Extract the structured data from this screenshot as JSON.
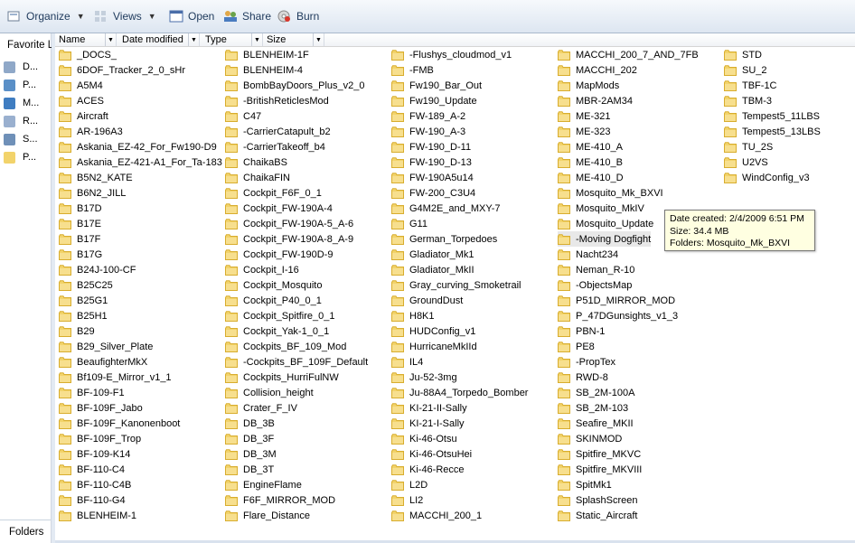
{
  "toolbar": {
    "organize": "Organize",
    "views": "Views",
    "open": "Open",
    "share": "Share",
    "burn": "Burn"
  },
  "nav": {
    "favorites": "Favorite L",
    "items": [
      "D...",
      "P...",
      "M...",
      "R...",
      "S...",
      "P..."
    ],
    "folders": "Folders"
  },
  "columns": [
    "Name",
    "Date modified",
    "Type",
    "Size"
  ],
  "folders": [
    [
      "_DOCS_",
      "6DOF_Tracker_2_0_sHr",
      "A5M4",
      "ACES",
      "Aircraft",
      "AR-196A3",
      "Askania_EZ-42_For_Fw190-D9",
      "Askania_EZ-421-A1_For_Ta-183",
      "B5N2_KATE",
      "B6N2_JILL",
      "B17D",
      "B17E",
      "B17F",
      "B17G",
      "B24J-100-CF",
      "B25C25",
      "B25G1",
      "B25H1",
      "B29",
      "B29_Silver_Plate",
      "BeaufighterMkX",
      "Bf109-E_Mirror_v1_1",
      "BF-109-F1",
      "BF-109F_Jabo",
      "BF-109F_Kanonenboot",
      "BF-109F_Trop",
      "BF-109-K14",
      "BF-110-C4",
      "BF-110-C4B",
      "BF-110-G4",
      "BLENHEIM-1"
    ],
    [
      "BLENHEIM-1F",
      "BLENHEIM-4",
      "BombBayDoors_Plus_v2_0",
      "-BritishReticlesMod",
      "C47",
      "-CarrierCatapult_b2",
      "-CarrierTakeoff_b4",
      "ChaikaBS",
      "ChaikaFIN",
      "Cockpit_F6F_0_1",
      "Cockpit_FW-190A-4",
      "Cockpit_FW-190A-5_A-6",
      "Cockpit_FW-190A-8_A-9",
      "Cockpit_FW-190D-9",
      "Cockpit_I-16",
      "Cockpit_Mosquito",
      "Cockpit_P40_0_1",
      "Cockpit_Spitfire_0_1",
      "Cockpit_Yak-1_0_1",
      "Cockpits_BF_109_Mod",
      "-Cockpits_BF_109F_Default",
      "Cockpits_HurriFulNW",
      "Collision_height",
      "Crater_F_IV",
      "DB_3B",
      "DB_3F",
      "DB_3M",
      "DB_3T",
      "EngineFlame",
      "F6F_MIRROR_MOD",
      "Flare_Distance"
    ],
    [
      "-Flushys_cloudmod_v1",
      "-FMB",
      "Fw190_Bar_Out",
      "Fw190_Update",
      "FW-189_A-2",
      "FW-190_A-3",
      "FW-190_D-11",
      "FW-190_D-13",
      "FW-190A5u14",
      "FW-200_C3U4",
      "G4M2E_and_MXY-7",
      "G11",
      "German_Torpedoes",
      "Gladiator_Mk1",
      "Gladiator_MkII",
      "Gray_curving_Smoketrail",
      "GroundDust",
      "H8K1",
      "HUDConfig_v1",
      "HurricaneMkIId",
      "IL4",
      "Ju-52-3mg",
      "Ju-88A4_Torpedo_Bomber",
      "KI-21-II-Sally",
      "KI-21-I-Sally",
      "Ki-46-Otsu",
      "Ki-46-OtsuHei",
      "Ki-46-Recce",
      "L2D",
      "LI2",
      "MACCHI_200_1"
    ],
    [
      "MACCHI_200_7_AND_7FB",
      "MACCHI_202",
      "MapMods",
      "MBR-2AM34",
      "ME-321",
      "ME-323",
      "ME-410_A",
      "ME-410_B",
      "ME-410_D",
      "Mosquito_Mk_BXVI",
      "Mosquito_MkIV",
      "Mosquito_Update",
      "-Moving Dogfight",
      "Nacht234",
      "Neman_R-10",
      "-ObjectsMap",
      "P51D_MIRROR_MOD",
      "P_47DGunsights_v1_3",
      "PBN-1",
      "PE8",
      "-PropTex",
      "RWD-8",
      "SB_2M-100A",
      "SB_2M-103",
      "Seafire_MKII",
      "SKINMOD",
      "Spitfire_MKVC",
      "Spitfire_MKVIII",
      "SpitMk1",
      "SplashScreen",
      "Static_Aircraft"
    ],
    [
      "STD",
      "SU_2",
      "TBF-1C",
      "TBM-3",
      "Tempest5_11LBS",
      "Tempest5_13LBS",
      "TU_2S",
      "U2VS",
      "WindConfig_v3"
    ]
  ],
  "selected": "-Moving Dogfight",
  "tooltip": {
    "line1": "Date created: 2/4/2009 6:51 PM",
    "line2": "Size: 34.4 MB",
    "line3": "Folders: Mosquito_Mk_BXVI"
  },
  "colors": {
    "folder": "#f2d36b",
    "folder_dark": "#d8ad2e",
    "tooltip_bg": "#ffffe1",
    "toolbar_text": "#1e395b"
  }
}
